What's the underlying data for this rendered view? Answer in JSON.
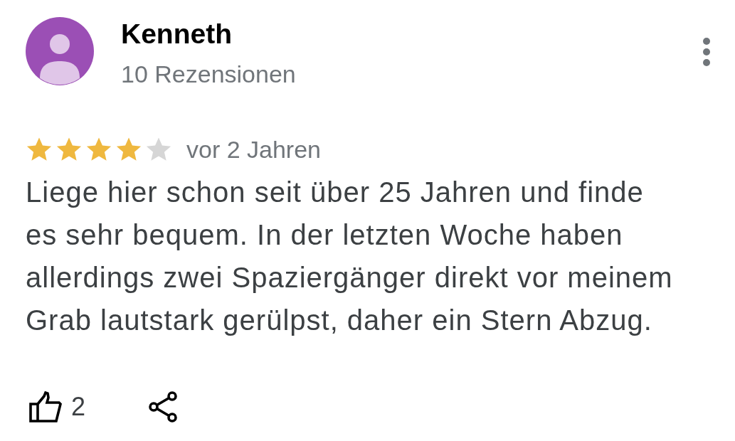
{
  "review": {
    "author": {
      "name": "Kenneth",
      "reviews": "10 Rezensionen"
    },
    "stars": 4,
    "time": "vor 2 Jahren",
    "text": "Liege hier schon seit über 25 Jahren und finde es sehr bequem. In der letzten Woche haben allerdings zwei Spaziergänger direkt vor meinem Grab lautstark gerülpst, daher ein Stern Abzug.",
    "likes": "2"
  }
}
